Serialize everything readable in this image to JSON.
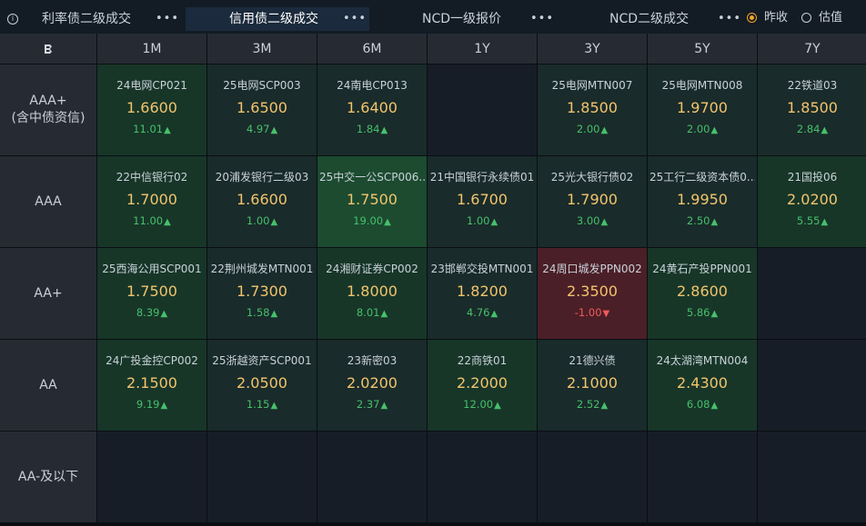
{
  "tabs": [
    {
      "label": "利率债二级成交",
      "active": false,
      "more": "•••"
    },
    {
      "label": "信用债二级成交",
      "active": true,
      "more": "•••"
    },
    {
      "label": "NCD一级报价",
      "active": false,
      "more": "•••"
    },
    {
      "label": "NCD二级成交",
      "active": false,
      "more": "•••"
    }
  ],
  "radio": [
    {
      "label": "昨收",
      "checked": true
    },
    {
      "label": "估值",
      "checked": false
    }
  ],
  "columns": [
    "1M",
    "3M",
    "6M",
    "1Y",
    "3Y",
    "5Y",
    "7Y"
  ],
  "rows": [
    {
      "label": "AAA+\n(含中债资信)",
      "cells": [
        {
          "bond": "24电网CP021",
          "price": "1.6600",
          "change": "11.01",
          "dir": "up",
          "tone": "tone1"
        },
        {
          "bond": "25电网SCP003",
          "price": "1.6500",
          "change": "4.97",
          "dir": "up",
          "tone": "tone4"
        },
        {
          "bond": "24南电CP013",
          "price": "1.6400",
          "change": "1.84",
          "dir": "up",
          "tone": "tone4"
        },
        null,
        {
          "bond": "25电网MTN007",
          "price": "1.8500",
          "change": "2.00",
          "dir": "up",
          "tone": "tone4"
        },
        {
          "bond": "25电网MTN008",
          "price": "1.9700",
          "change": "2.00",
          "dir": "up",
          "tone": "tone4"
        },
        {
          "bond": "22铁道03",
          "price": "1.8500",
          "change": "2.84",
          "dir": "up",
          "tone": "tone4"
        }
      ]
    },
    {
      "label": "AAA",
      "cells": [
        {
          "bond": "22中信银行02",
          "price": "1.7000",
          "change": "11.00",
          "dir": "up",
          "tone": "tone1"
        },
        {
          "bond": "20浦发银行二级03",
          "price": "1.6600",
          "change": "1.00",
          "dir": "up",
          "tone": "tone4"
        },
        {
          "bond": "25中交一公SCP006...",
          "price": "1.7500",
          "change": "19.00",
          "dir": "up",
          "tone": "tone2"
        },
        {
          "bond": "21中国银行永续债01",
          "price": "1.6700",
          "change": "1.00",
          "dir": "up",
          "tone": "tone4"
        },
        {
          "bond": "25光大银行债02",
          "price": "1.7900",
          "change": "3.00",
          "dir": "up",
          "tone": "tone4"
        },
        {
          "bond": "25工行二级资本债0...",
          "price": "1.9950",
          "change": "2.50",
          "dir": "up",
          "tone": "tone4"
        },
        {
          "bond": "21国投06",
          "price": "2.0200",
          "change": "5.55",
          "dir": "up",
          "tone": "tone1"
        }
      ]
    },
    {
      "label": "AA+",
      "cells": [
        {
          "bond": "25西海公用SCP001",
          "price": "1.7500",
          "change": "8.39",
          "dir": "up",
          "tone": "tone1"
        },
        {
          "bond": "22荆州城发MTN001",
          "price": "1.7300",
          "change": "1.58",
          "dir": "up",
          "tone": "tone4"
        },
        {
          "bond": "24湘财证券CP002",
          "price": "1.8000",
          "change": "8.01",
          "dir": "up",
          "tone": "tone1"
        },
        {
          "bond": "23邯郸交投MTN001",
          "price": "1.8200",
          "change": "4.76",
          "dir": "up",
          "tone": "tone4"
        },
        {
          "bond": "24周口城发PPN002",
          "price": "2.3500",
          "change": "-1.00",
          "dir": "down",
          "tone": "neg"
        },
        {
          "bond": "24黄石产投PPN001",
          "price": "2.8600",
          "change": "5.86",
          "dir": "up",
          "tone": "tone1"
        },
        null
      ]
    },
    {
      "label": "AA",
      "cells": [
        {
          "bond": "24广投金控CP002",
          "price": "2.1500",
          "change": "9.19",
          "dir": "up",
          "tone": "tone1"
        },
        {
          "bond": "25浙越资产SCP001",
          "price": "2.0500",
          "change": "1.15",
          "dir": "up",
          "tone": "tone4"
        },
        {
          "bond": "23新密03",
          "price": "2.0200",
          "change": "2.37",
          "dir": "up",
          "tone": "tone4"
        },
        {
          "bond": "22商铁01",
          "price": "2.2000",
          "change": "12.00",
          "dir": "up",
          "tone": "tone1"
        },
        {
          "bond": "21德兴债",
          "price": "2.1000",
          "change": "2.52",
          "dir": "up",
          "tone": "tone4"
        },
        {
          "bond": "24太湖湾MTN004",
          "price": "2.4300",
          "change": "6.08",
          "dir": "up",
          "tone": "tone1"
        },
        null
      ]
    },
    {
      "label": "AA-及以下",
      "cells": [
        null,
        null,
        null,
        null,
        null,
        null,
        null
      ]
    }
  ],
  "colors": {
    "price": "#f2c46d",
    "up": "#46c06b",
    "down": "#f25a5a",
    "radio_checked": "#f5a623"
  },
  "icons": {
    "info": "info-icon",
    "corner": "brand-logo-icon",
    "up": "triangle-up-icon",
    "down": "triangle-down-icon"
  }
}
